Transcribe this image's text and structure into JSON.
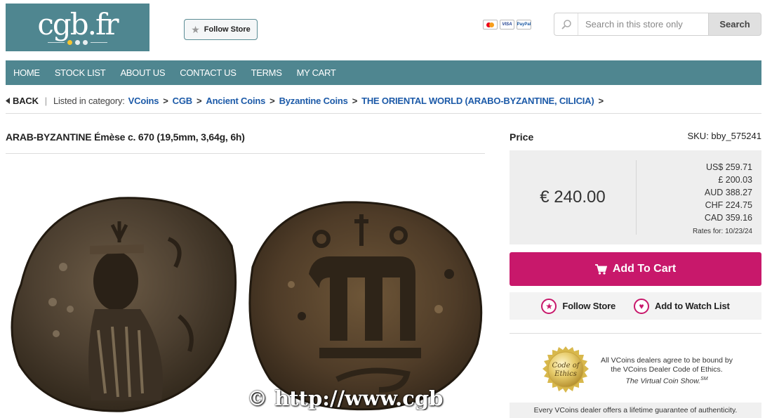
{
  "header": {
    "logo_text": "cgb.fr",
    "follow_store_label": "Follow Store",
    "payment_cards": [
      "mastercard",
      "VISA",
      "PayPal"
    ],
    "search_placeholder": "Search in this store only",
    "search_button_label": "Search"
  },
  "nav": {
    "items": [
      "HOME",
      "STOCK LIST",
      "ABOUT US",
      "CONTACT US",
      "TERMS",
      "MY CART"
    ]
  },
  "breadcrumb": {
    "back_label": "BACK",
    "listed_label": "Listed in category:",
    "items": [
      "VCoins",
      "CGB",
      "Ancient Coins",
      "Byzantine Coins",
      "THE ORIENTAL WORLD (ARABO-BYZANTINE, CILICIA)"
    ]
  },
  "item": {
    "title": "ARAB-BYZANTINE Émèse c. 670 (19,5mm, 3,64g, 6h)",
    "watermark": "© http://www.cgb"
  },
  "price": {
    "label": "Price",
    "sku": "SKU: bby_575241",
    "main": "€ 240.00",
    "conversions": [
      "US$ 259.71",
      "£ 200.03",
      "AUD 388.27",
      "CHF 224.75",
      "CAD 359.16"
    ],
    "rates_note": "Rates for: 10/23/24"
  },
  "actions": {
    "add_to_cart": "Add To Cart",
    "follow_store": "Follow Store",
    "watch_list": "Add to Watch List"
  },
  "ethics": {
    "seal_line1": "Code of",
    "seal_line2": "Ethics",
    "text": "All VCoins dealers agree to be bound by the VCoins Dealer Code of Ethics.",
    "show": "The Virtual Coin Show.",
    "sm": "SM",
    "guarantee": "Every VCoins dealer offers a lifetime guarantee of authenticity."
  },
  "colors": {
    "teal": "#4f8690",
    "magenta": "#c8186b",
    "link_blue": "#1c5aa8"
  }
}
